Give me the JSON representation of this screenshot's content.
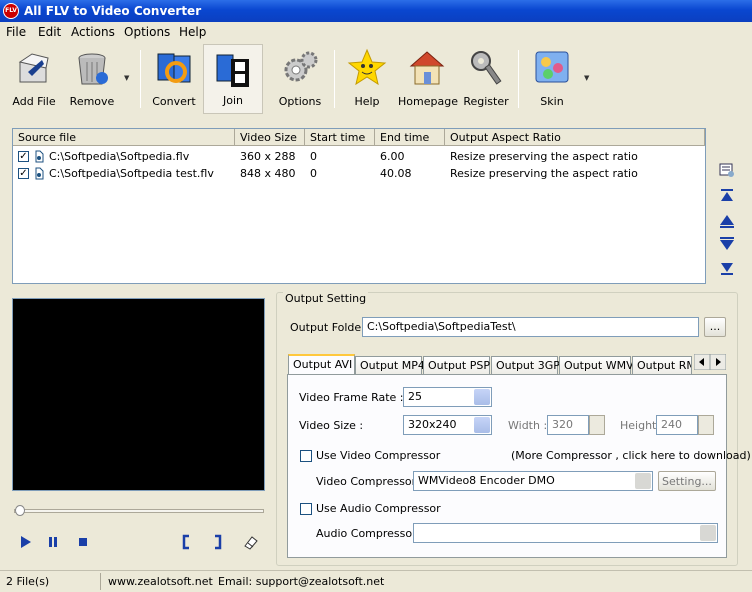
{
  "window": {
    "title": "All FLV to Video Converter"
  },
  "menu": [
    "File",
    "Edit",
    "Actions",
    "Options",
    "Help"
  ],
  "toolbar": {
    "add_file": "Add File",
    "remove": "Remove",
    "convert": "Convert",
    "join": "Join",
    "options": "Options",
    "help": "Help",
    "homepage": "Homepage",
    "register": "Register",
    "skin": "Skin"
  },
  "file_list": {
    "columns": [
      "Source file",
      "Video Size",
      "Start time",
      "End time",
      "Output Aspect Ratio"
    ],
    "rows": [
      {
        "source": "C:\\Softpedia\\Softpedia.flv",
        "size": "360 x 288",
        "start": "0",
        "end": "6.00",
        "aspect": "Resize preserving the aspect ratio",
        "checked": true
      },
      {
        "source": "C:\\Softpedia\\Softpedia test.flv",
        "size": "848 x 480",
        "start": "0",
        "end": "40.08",
        "aspect": "Resize preserving the aspect ratio",
        "checked": true
      }
    ]
  },
  "output": {
    "group_title": "Output Setting",
    "folder_label": "Output Folder:",
    "folder_value": "C:\\Softpedia\\SoftpediaTest\\",
    "browse_label": "...",
    "tabs": [
      "Output AVI",
      "Output MP4",
      "Output PSP",
      "Output 3GP",
      "Output WMV",
      "Output RMV"
    ],
    "frame_rate_label": "Video Frame Rate :",
    "frame_rate_value": "25",
    "video_size_label": "Video Size :",
    "video_size_value": "320x240",
    "width_label": "Width :",
    "width_value": "320",
    "height_label": "Height :",
    "height_value": "240",
    "use_video_compressor": "Use Video Compressor",
    "more_compressor": "(More Compressor , click here to download)",
    "video_compressor_label": "Video Compressor :",
    "video_compressor_value": "WMVideo8 Encoder DMO",
    "setting_label": "Setting...",
    "use_audio_compressor": "Use Audio Compressor",
    "audio_compressor_label": "Audio Compressor :",
    "audio_compressor_value": ""
  },
  "status": {
    "files": "2 File(s)",
    "website": "www.zealotsoft.net",
    "email": "Email: support@zealotsoft.net"
  },
  "colors": {
    "title_bar": "#0a47d0",
    "preview_bg": "#000000",
    "accent": "#ffc83c"
  }
}
